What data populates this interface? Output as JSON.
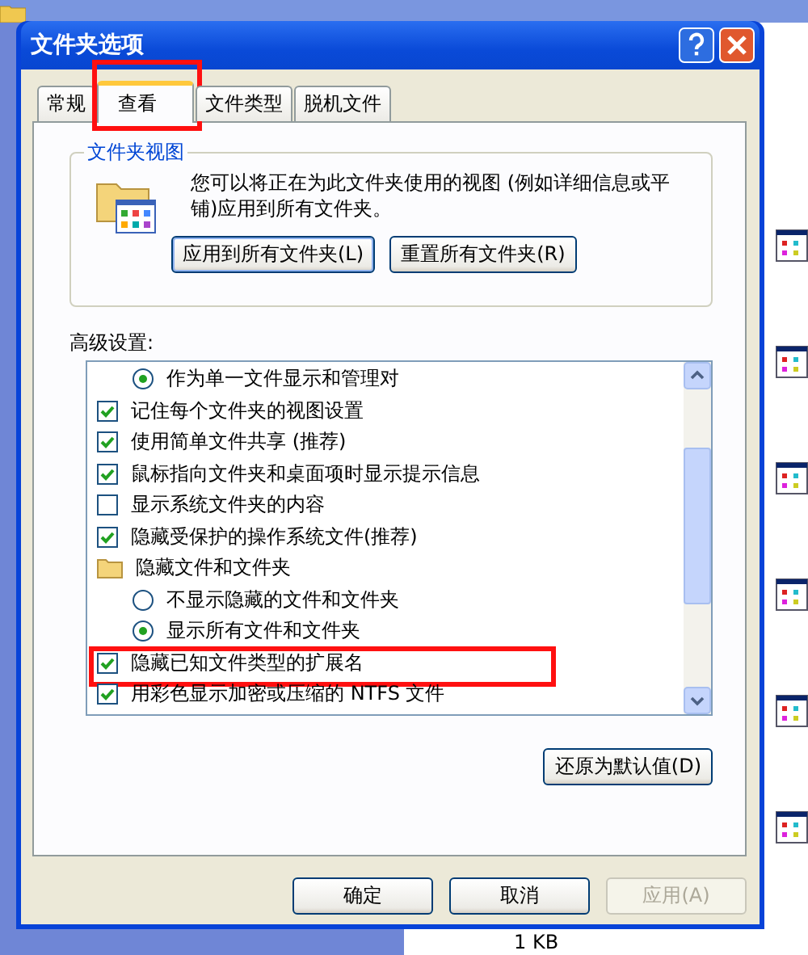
{
  "window": {
    "title": "文件夹选项"
  },
  "tabs": [
    {
      "label": "常规",
      "selected": false
    },
    {
      "label": "查看",
      "selected": true,
      "highlighted": true
    },
    {
      "label": "文件类型",
      "selected": false
    },
    {
      "label": "脱机文件",
      "selected": false
    }
  ],
  "folder_views": {
    "title": "文件夹视图",
    "description": "您可以将正在为此文件夹使用的视图 (例如详细信息或平铺)应用到所有文件夹。",
    "buttons": [
      "应用到所有文件夹(L)",
      "重置所有文件夹(R)"
    ]
  },
  "advanced": {
    "label": "高级设置:",
    "items": [
      {
        "kind": "group",
        "children": [
          {
            "kind": "radio",
            "label": "作为单一文件显示和管理对",
            "checked": true
          }
        ]
      },
      {
        "kind": "checkbox",
        "label": "记住每个文件夹的视图设置",
        "checked": true
      },
      {
        "kind": "checkbox",
        "label": "使用简单文件共享 (推荐)",
        "checked": true
      },
      {
        "kind": "checkbox",
        "label": "鼠标指向文件夹和桌面项时显示提示信息",
        "checked": true
      },
      {
        "kind": "checkbox",
        "label": "显示系统文件夹的内容",
        "checked": false
      },
      {
        "kind": "checkbox",
        "label": "隐藏受保护的操作系统文件(推荐)",
        "checked": true
      },
      {
        "kind": "folder",
        "label": "隐藏文件和文件夹",
        "children": [
          {
            "kind": "radio",
            "label": "不显示隐藏的文件和文件夹",
            "checked": false
          },
          {
            "kind": "radio",
            "label": "显示所有文件和文件夹",
            "checked": true
          }
        ]
      },
      {
        "kind": "checkbox",
        "label": "隐藏已知文件类型的扩展名",
        "checked": true,
        "highlighted": true
      },
      {
        "kind": "checkbox",
        "label": "用彩色显示加密或压缩的 NTFS 文件",
        "checked": true
      }
    ]
  },
  "restore_button": "还原为默认值(D)",
  "buttons": [
    {
      "label": "确定",
      "disabled": false
    },
    {
      "label": "取消",
      "disabled": false
    },
    {
      "label": "应用(A)",
      "disabled": true
    }
  ],
  "background": {
    "file_size": "1 KB"
  }
}
